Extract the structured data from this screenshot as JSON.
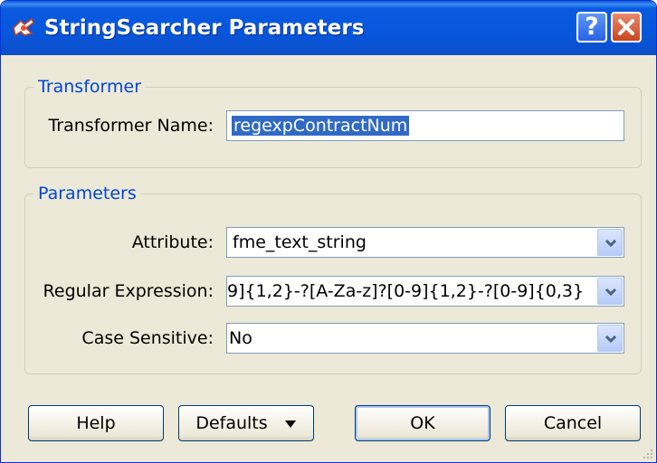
{
  "window": {
    "title": "StringSearcher Parameters",
    "help_button": "?",
    "close_icon": "close-icon"
  },
  "transformer_group": {
    "title": "Transformer",
    "name_label": "Transformer Name:",
    "name_value": "regexpContractNum"
  },
  "parameters_group": {
    "title": "Parameters",
    "attribute_label": "Attribute:",
    "attribute_value": "fme_text_string",
    "regex_label": "Regular Expression:",
    "regex_value": "9]{1,2}-?[A-Za-z]?[0-9]{1,2}-?[0-9]{0,3}",
    "case_label": "Case Sensitive:",
    "case_value": "No"
  },
  "buttons": {
    "help": "Help",
    "defaults": "Defaults",
    "ok": "OK",
    "cancel": "Cancel"
  },
  "colors": {
    "title_bar": "#0757dd",
    "group_title": "#0046d5",
    "selection": "#316ac5",
    "dialog_bg": "#ece9d8"
  }
}
